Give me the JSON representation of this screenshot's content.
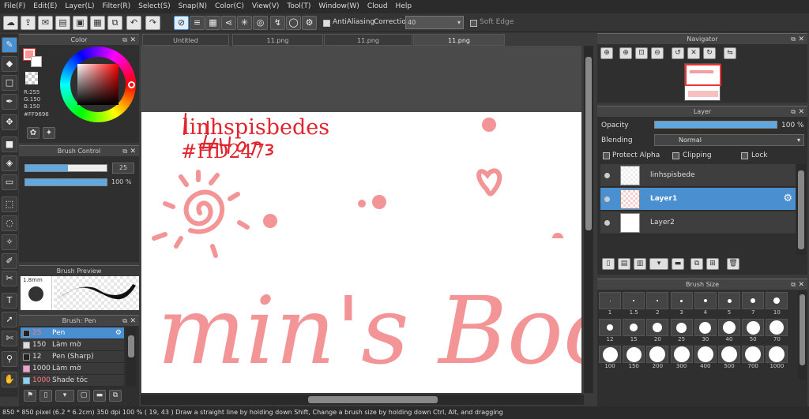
{
  "menu": [
    "File(F)",
    "Edit(E)",
    "Layer(L)",
    "Filter(R)",
    "Select(S)",
    "Snap(N)",
    "Color(C)",
    "View(V)",
    "Tool(T)",
    "Window(W)",
    "Cloud",
    "Help"
  ],
  "toolbar": {
    "antialiasing": "AntiAliasing",
    "correction_label": "Correction",
    "correction_value": "40",
    "soft_edge": "Soft Edge"
  },
  "color_panel": {
    "title": "Color",
    "r": "R:255",
    "g": "G:150",
    "b": "B:150",
    "hex": "#FF9696",
    "fg": "#ff9696"
  },
  "brush_control": {
    "title": "Brush Control",
    "size": "25",
    "opacity": "100 %"
  },
  "brush_preview": {
    "title": "Brush Preview",
    "size": "1.8mm"
  },
  "brush_list": {
    "title": "Brush: Pen",
    "items": [
      {
        "n": "25",
        "label": "Pen",
        "color": "#222222"
      },
      {
        "n": "150",
        "label": "Làm mờ",
        "color": "#dddddd"
      },
      {
        "n": "12",
        "label": "Pen (Sharp)",
        "color": "#222222"
      },
      {
        "n": "1000",
        "label": "Làm mờ",
        "color": "#ff9ad5"
      },
      {
        "n": "1000",
        "label": "Shade tóc",
        "color": "#7fd7ff"
      }
    ]
  },
  "doc_tabs": [
    "Untitled",
    "11.png",
    "11.png",
    "11.png"
  ],
  "canvas": {
    "line1": "linhspisbedes",
    "line2": "#HD247",
    "brand": "min's Boo"
  },
  "navigator": {
    "title": "Navigator"
  },
  "layer_panel": {
    "title": "Layer",
    "opacity_label": "Opacity",
    "opacity_value": "100 %",
    "opacity": 1.0,
    "blending_label": "Blending",
    "blending_value": "Normal",
    "protect_alpha": "Protect Alpha",
    "clipping": "Clipping",
    "lock": "Lock",
    "layers": [
      "linhspisbede",
      "Layer1",
      "Layer2"
    ]
  },
  "brush_size": {
    "title": "Brush Size",
    "sizes": [
      "1",
      "1.5",
      "2",
      "3",
      "4",
      "5",
      "7",
      "10",
      "12",
      "15",
      "20",
      "25",
      "30",
      "40",
      "50",
      "70",
      "100",
      "150",
      "200",
      "300",
      "400",
      "500",
      "700",
      "1000"
    ]
  },
  "status": "850 * 850 pixel  (6.2 * 6.2cm)  350 dpi  100 %  ( 19, 43 )   Draw a straight line by holding down Shift, Change a brush size by holding down Ctrl, Alt, and dragging"
}
